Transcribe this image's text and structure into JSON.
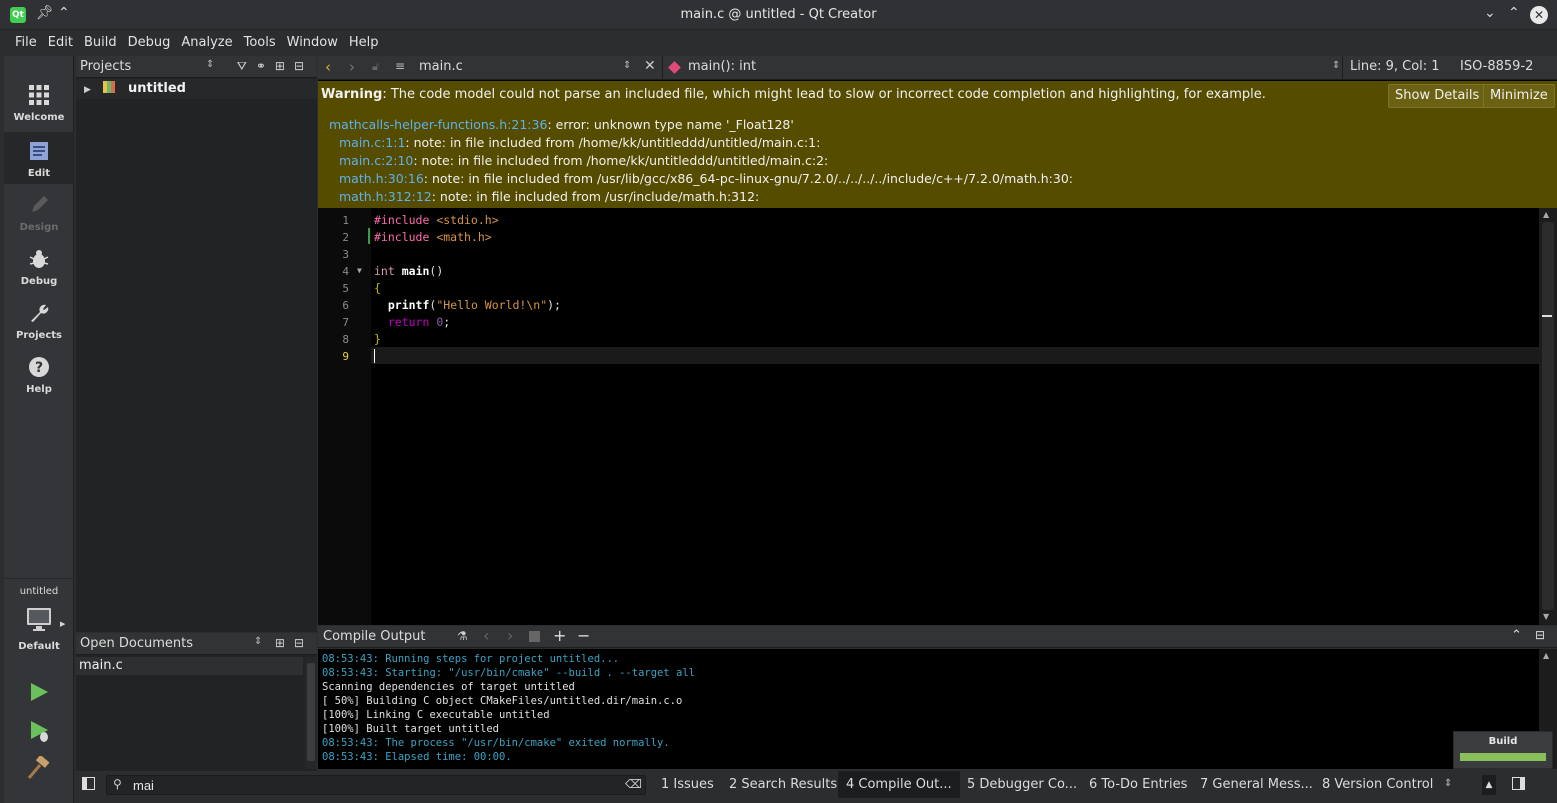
{
  "window": {
    "title": "main.c @ untitled - Qt Creator"
  },
  "menu": [
    "File",
    "Edit",
    "Build",
    "Debug",
    "Analyze",
    "Tools",
    "Window",
    "Help"
  ],
  "modes": [
    {
      "label": "Welcome",
      "icon": "grid-icon"
    },
    {
      "label": "Edit",
      "icon": "edit-doc-icon"
    },
    {
      "label": "Design",
      "icon": "pencil-icon"
    },
    {
      "label": "Debug",
      "icon": "bug-icon"
    },
    {
      "label": "Projects",
      "icon": "wrench-icon"
    },
    {
      "label": "Help",
      "icon": "help-icon"
    }
  ],
  "kit": {
    "project": "untitled",
    "config": "Default"
  },
  "projects": {
    "header": "Projects",
    "root": "untitled"
  },
  "open_documents": {
    "header": "Open Documents",
    "items": [
      "main.c"
    ]
  },
  "editor_toolbar": {
    "file": "main.c",
    "symbol": "main(): int",
    "position": "Line: 9, Col: 1",
    "encoding": "ISO-8859-2"
  },
  "warning": {
    "label": "Warning",
    "text": ": The code model could not parse an included file, which might lead to slow or incorrect code completion and highlighting, for example.",
    "show_details": "Show Details",
    "minimize": "Minimize",
    "lines": [
      {
        "link": "mathcalls-helper-functions.h:21:36",
        "text": ": error: unknown type name '_Float128'"
      },
      {
        "link": "main.c:1:1",
        "text": ": note: in file included from /home/kk/untitleddd/untitled/main.c:1:"
      },
      {
        "link": "main.c:2:10",
        "text": ": note: in file included from /home/kk/untitleddd/untitled/main.c:2:"
      },
      {
        "link": "math.h:30:16",
        "text": ": note: in file included from /usr/lib/gcc/x86_64-pc-linux-gnu/7.2.0/../../../../include/c++/7.2.0/math.h:30:"
      },
      {
        "link": "math.h:312:12",
        "text": ": note: in file included from /usr/include/math.h:312:"
      }
    ]
  },
  "code": {
    "line_numbers": [
      "1",
      "2",
      "3",
      "4",
      "5",
      "6",
      "7",
      "8",
      "9"
    ],
    "l1": {
      "pp": "#include",
      "inc": " <stdio.h>"
    },
    "l2": {
      "pp": "#include",
      "inc": " <math.h>"
    },
    "l4": {
      "kw": "int",
      "fn": "main",
      "rest": "()"
    },
    "l5": "{",
    "l6": {
      "fn": "printf",
      "open": "(",
      "str": "\"Hello World!\\n\"",
      "close": ");"
    },
    "l7": {
      "kw": "return",
      "num": "0",
      "semi": ";"
    },
    "l8": "}"
  },
  "compile_output": {
    "title": "Compile Output",
    "lines": [
      {
        "c": "ob",
        "t": "08:53:43: Running steps for project untitled..."
      },
      {
        "c": "ob",
        "t": "08:53:43: Starting: \"/usr/bin/cmake\" --build . --target all"
      },
      {
        "c": "ow",
        "t": "Scanning dependencies of target untitled"
      },
      {
        "c": "ow",
        "t": "[ 50%] Building C object CMakeFiles/untitled.dir/main.c.o"
      },
      {
        "c": "ow",
        "t": "[100%] Linking C executable untitled"
      },
      {
        "c": "ow",
        "t": "[100%] Built target untitled"
      },
      {
        "c": "ob",
        "t": "08:53:43: The process \"/usr/bin/cmake\" exited normally."
      },
      {
        "c": "ob",
        "t": "08:53:43: Elapsed time: 00:00."
      }
    ]
  },
  "build_progress": {
    "label": "Build",
    "progress": 1.0,
    "color": "#8ac05c"
  },
  "locator": {
    "value": "mai"
  },
  "output_tabs": [
    "1  Issues",
    "2  Search Results",
    "4  Compile Out...",
    "5  Debugger Co...",
    "6  To-Do Entries",
    "7  General Mess...",
    "8  Version Control"
  ]
}
